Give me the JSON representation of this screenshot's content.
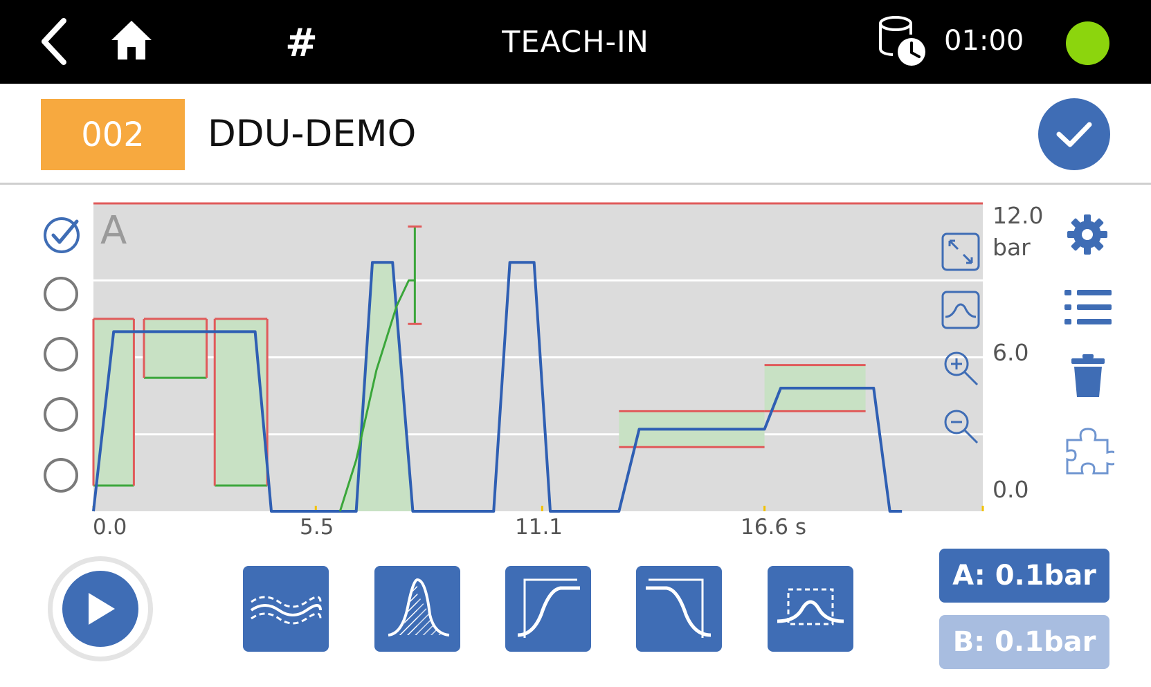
{
  "header": {
    "title": "TEACH-IN",
    "hash": "#",
    "time": "01:00",
    "status_color": "#8cd50d",
    "icons": [
      "back-icon",
      "home-icon",
      "database-clock-icon"
    ]
  },
  "program": {
    "number": "002",
    "name": "DDU-DEMO",
    "number_color": "#f7a93f"
  },
  "channels": [
    {
      "id": "A",
      "checked": true
    },
    {
      "checked": false
    },
    {
      "checked": false
    },
    {
      "checked": false
    },
    {
      "checked": false
    }
  ],
  "chart_data": {
    "type": "line",
    "channel_label": "A",
    "y_unit": "bar",
    "ylim": [
      0,
      12
    ],
    "yticks": [
      "12.0",
      "6.0",
      "0.0"
    ],
    "xticks": [
      "0.0",
      "5.5",
      "11.1",
      "16.6 s"
    ],
    "xlim": [
      0,
      22
    ],
    "grid": true,
    "upper_limit": 12.0,
    "series": [
      {
        "color": "#2f5fb3",
        "x": [
          0,
          0.5,
          1.0,
          3.5,
          4.0,
          4.4,
          6.5,
          6.9,
          7.4,
          7.9,
          8.3,
          9.9,
          10.3,
          10.9,
          11.3,
          13.0,
          13.5,
          16.6,
          17.0,
          19.3,
          19.7,
          20.0
        ],
        "values": [
          0,
          7.0,
          7.0,
          7.0,
          7.0,
          0,
          0,
          9.7,
          9.7,
          0,
          0,
          0,
          9.7,
          9.7,
          0,
          0,
          3.2,
          3.2,
          4.8,
          4.8,
          0,
          0
        ]
      },
      {
        "color": "#3aa63a",
        "x": [
          6.1,
          6.5,
          7.0,
          7.5,
          7.8,
          7.95
        ],
        "values": [
          0,
          2.0,
          5.5,
          8.0,
          9.0,
          9.0
        ]
      }
    ],
    "tolerance_windows": [
      {
        "x": [
          0,
          1.0
        ],
        "y": [
          1.0,
          7.5
        ]
      },
      {
        "x": [
          1.25,
          2.8
        ],
        "y": [
          5.2,
          7.5
        ]
      },
      {
        "x": [
          3.0,
          4.3
        ],
        "y": [
          1.0,
          7.5
        ]
      }
    ],
    "tolerance_bands": [
      {
        "x": [
          13.0,
          16.6
        ],
        "lower": [
          2.5,
          2.5
        ],
        "upper": [
          3.9,
          3.9
        ]
      },
      {
        "x": [
          16.6,
          19.1
        ],
        "lower": [
          3.9,
          3.9
        ],
        "upper": [
          5.7,
          5.7
        ]
      }
    ],
    "error_bar": {
      "x": 7.95,
      "low": 7.3,
      "high": 11.1
    }
  },
  "chart_tools": [
    "expand-icon",
    "fit-curve-icon",
    "zoom-in-icon",
    "zoom-out-icon"
  ],
  "side_tools": [
    "settings-icon",
    "list-icon",
    "trash-icon",
    "puzzle-icon"
  ],
  "bottom_tools": [
    "noise-band-icon",
    "distribution-icon",
    "rise-curve-icon",
    "fall-curve-icon",
    "window-icon"
  ],
  "ranges": {
    "a_label": "A: 0.1bar",
    "b_label": "B: 0.1bar"
  },
  "colors": {
    "accent": "#3f6db5",
    "limit_red": "#e05a5a",
    "plot_bg": "#dcdcdc",
    "fill_green": "#c8e1c4"
  }
}
